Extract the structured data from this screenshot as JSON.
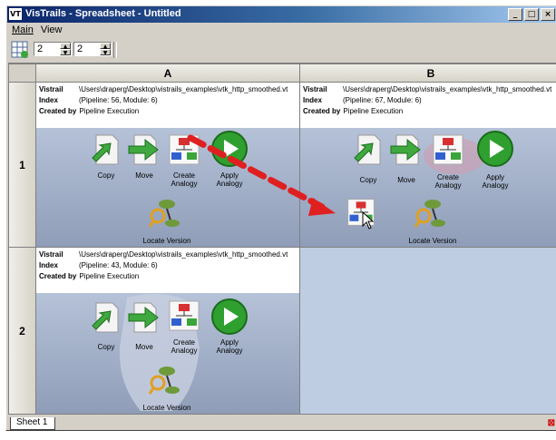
{
  "window": {
    "icon_text": "VT",
    "title": "VisTrails - Spreadsheet - Untitled",
    "controls": [
      "_",
      "□",
      "×"
    ]
  },
  "menubar": {
    "items": [
      "Main",
      "View"
    ]
  },
  "toolbar": {
    "rows_value": "2",
    "cols_value": "2"
  },
  "sheet": {
    "columns": [
      "A",
      "B"
    ],
    "rows": [
      "1",
      "2"
    ]
  },
  "labels": {
    "vistrail": "Vistrail",
    "index": "Index",
    "created_by": "Created by",
    "copy": "Copy",
    "move": "Move",
    "create_analogy": "Create Analogy",
    "apply_analogy": "Apply Analogy",
    "locate_version": "Locate Version"
  },
  "cells": {
    "a1": {
      "vistrail": "\\Users\\draperg\\Desktop\\vistrails_examples\\vtk_http_smoothed.vt",
      "index": "(Pipeline: 56, Module: 6)",
      "created_by": "Pipeline Execution"
    },
    "b1": {
      "vistrail": "\\Users\\draperg\\Desktop\\vistrails_examples\\vtk_http_smoothed.vt",
      "index": "(Pipeline: 67, Module: 6)",
      "created_by": "Pipeline Execution"
    },
    "a2": {
      "vistrail": "\\Users\\draperg\\Desktop\\vistrails_examples\\vtk_http_smoothed.vt",
      "index": "(Pipeline: 43, Module: 6)",
      "created_by": "Pipeline Execution"
    }
  },
  "tabs": {
    "sheet1": "Sheet 1"
  },
  "colors": {
    "title_start": "#0a246a",
    "title_end": "#a6caf0",
    "chrome": "#d4d0c8",
    "cell_canvas": "#98a6c0",
    "empty_cell": "#bfcde3",
    "drag_arrow": "#e02020"
  },
  "icons": [
    "copy-icon",
    "move-icon",
    "create-analogy-icon",
    "apply-analogy-icon",
    "locate-version-icon",
    "drag-arrow",
    "mouse-cursor-icon"
  ]
}
